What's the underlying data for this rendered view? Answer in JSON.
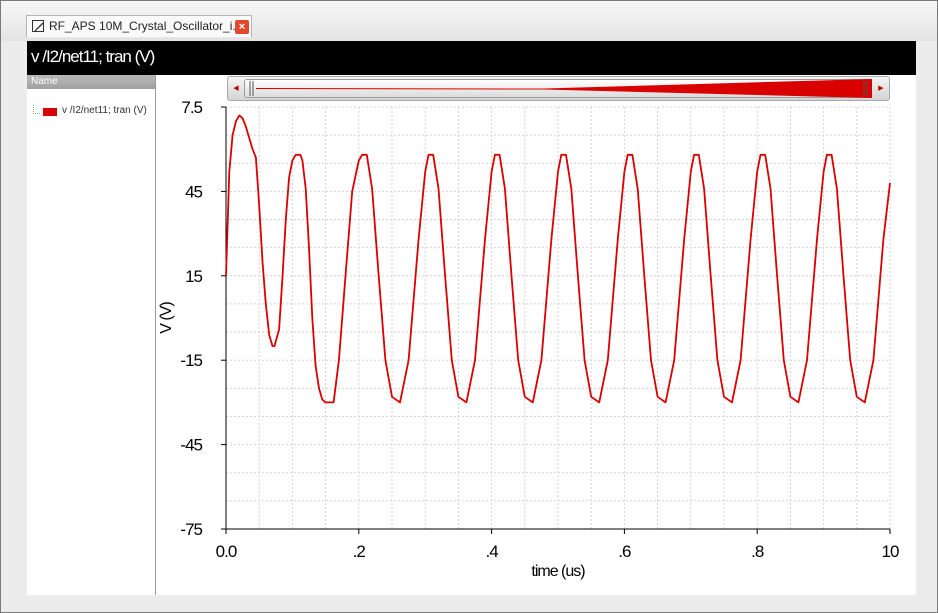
{
  "tab": {
    "title": "RF_APS 10M_Crystal_Oscillator_i..."
  },
  "window": {
    "title": "v /I2/net11; tran (V)"
  },
  "sidebar": {
    "header": "Name",
    "items": [
      {
        "label": "v /I2/net11; tran (V)",
        "color": "#d90000"
      }
    ]
  },
  "colors": {
    "trace": "#d90000",
    "accent": "#c00000"
  },
  "chart_data": {
    "type": "line",
    "xlabel": "time (us)",
    "ylabel": "V (V)",
    "xlim": [
      0,
      10
    ],
    "ylim": [
      -75,
      75
    ],
    "xticks": [
      0,
      2,
      4,
      6,
      8,
      10
    ],
    "xtick_labels": [
      "0.0",
      ".2",
      ".4",
      ".6",
      ".8",
      "10"
    ],
    "yticks": [
      75,
      45,
      15,
      -15,
      -45,
      -75
    ],
    "ytick_labels": [
      "7.5",
      "45",
      "15",
      "-15",
      "-45",
      "-75"
    ],
    "grid": true,
    "series": [
      {
        "name": "v /I2/net11; tran (V)",
        "x": [
          0.0,
          0.05,
          0.1,
          0.15,
          0.2,
          0.25,
          0.3,
          0.35,
          0.4,
          0.45,
          0.5,
          0.55,
          0.6,
          0.65,
          0.7,
          0.73,
          0.8,
          0.85,
          0.9,
          0.95,
          1.0,
          1.05,
          1.1,
          1.12,
          1.15,
          1.2,
          1.25,
          1.3,
          1.35,
          1.4,
          1.45,
          1.5,
          1.55,
          1.6,
          1.62,
          1.7,
          1.8,
          1.9,
          2.0,
          2.05,
          2.1,
          2.12,
          2.2,
          2.3,
          2.4,
          2.5,
          2.62,
          2.75,
          2.9,
          3.0,
          3.05,
          3.1,
          3.12,
          3.2,
          3.3,
          3.4,
          3.5,
          3.62,
          3.75,
          3.9,
          4.0,
          4.05,
          4.1,
          4.12,
          4.2,
          4.3,
          4.4,
          4.5,
          4.62,
          4.75,
          4.9,
          5.0,
          5.05,
          5.1,
          5.12,
          5.2,
          5.3,
          5.4,
          5.5,
          5.62,
          5.75,
          5.9,
          6.0,
          6.05,
          6.1,
          6.12,
          6.2,
          6.3,
          6.4,
          6.5,
          6.62,
          6.75,
          6.9,
          7.0,
          7.05,
          7.1,
          7.12,
          7.2,
          7.3,
          7.4,
          7.5,
          7.62,
          7.75,
          7.9,
          8.0,
          8.05,
          8.1,
          8.12,
          8.2,
          8.3,
          8.4,
          8.5,
          8.62,
          8.75,
          8.9,
          9.0,
          9.05,
          9.1,
          9.12,
          9.2,
          9.3,
          9.4,
          9.5,
          9.62,
          9.75,
          9.9,
          10.0
        ],
        "y": [
          15,
          52,
          65,
          70,
          72,
          71,
          68,
          64,
          60,
          57,
          40,
          20,
          5,
          -6,
          -10,
          -10,
          -4,
          14,
          35,
          50,
          56,
          58,
          58,
          58,
          56,
          46,
          25,
          0,
          -17,
          -25,
          -29,
          -30,
          -30,
          -30,
          -30,
          -15,
          15,
          45,
          56,
          58,
          58,
          58,
          46,
          15,
          -15,
          -28,
          -30,
          -15,
          28,
          52,
          58,
          58,
          58,
          46,
          15,
          -15,
          -28,
          -30,
          -15,
          28,
          52,
          58,
          58,
          58,
          46,
          15,
          -15,
          -28,
          -30,
          -15,
          28,
          52,
          58,
          58,
          58,
          46,
          15,
          -15,
          -28,
          -30,
          -15,
          28,
          52,
          58,
          58,
          58,
          46,
          15,
          -15,
          -28,
          -30,
          -15,
          28,
          52,
          58,
          58,
          58,
          46,
          15,
          -15,
          -28,
          -30,
          -15,
          28,
          52,
          58,
          58,
          58,
          46,
          15,
          -15,
          -28,
          -30,
          -15,
          28,
          52,
          58,
          58,
          58,
          46,
          15,
          -15,
          -28,
          -30,
          -15,
          28,
          48
        ]
      }
    ]
  }
}
